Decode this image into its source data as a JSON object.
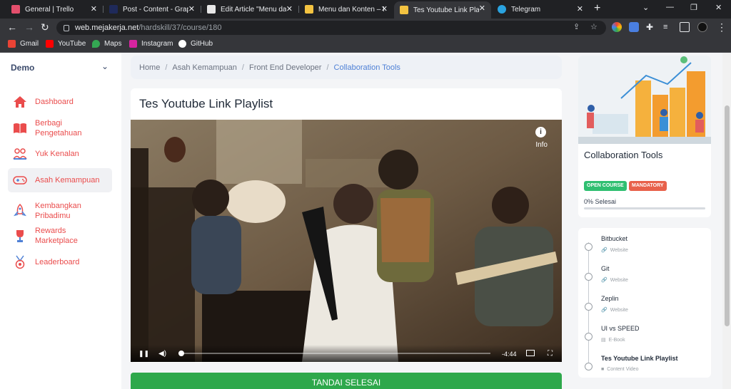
{
  "browser": {
    "tabs": [
      {
        "title": "General | Trello",
        "favicon_color": "#e34f6c"
      },
      {
        "title": "Post - Content - Graph",
        "favicon_color": "#1f2a5a"
      },
      {
        "title": "Edit Article \"Menu dan",
        "favicon_color": "#e7e7e7"
      },
      {
        "title": "Menu dan Konten – M",
        "favicon_color": "#f3c341"
      },
      {
        "title": "Tes Youtube Link Playl",
        "favicon_color": "#f3c341",
        "active": true
      },
      {
        "title": "Telegram",
        "favicon_color": "#2aa3e0"
      }
    ],
    "url_host": "web.mejakerja.net",
    "url_path": "/hardskill/37/course/180",
    "bookmarks": [
      {
        "label": "Gmail",
        "color": "#ea4335"
      },
      {
        "label": "YouTube",
        "color": "#ff0000"
      },
      {
        "label": "Maps",
        "color": "#34a853"
      },
      {
        "label": "Instagram",
        "color": "#d6249f"
      },
      {
        "label": "GitHub",
        "color": "#ffffff"
      }
    ]
  },
  "sidebar": {
    "brand": "Demo",
    "items": [
      {
        "label": "Dashboard",
        "icon": "home-icon"
      },
      {
        "label": "Berbagi Pengetahuan",
        "icon": "book-icon"
      },
      {
        "label": "Yuk Kenalan",
        "icon": "people-icon"
      },
      {
        "label": "Asah Kemampuan",
        "icon": "gamepad-icon",
        "active": true
      },
      {
        "label": "Kembangkan Pribadimu",
        "icon": "rocket-icon"
      },
      {
        "label": "Rewards Marketplace",
        "icon": "trophy-icon"
      },
      {
        "label": "Leaderboard",
        "icon": "medal-icon"
      }
    ]
  },
  "breadcrumb": {
    "items": [
      "Home",
      "Asah Kemampuan",
      "Front End Developer"
    ],
    "current": "Collaboration Tools"
  },
  "course": {
    "title": "Tes Youtube Link Playlist",
    "video": {
      "info_label": "Info",
      "time_remaining": "-4:44",
      "progress": 0.01
    },
    "done_button": "TANDAI SELESAI"
  },
  "right_panel": {
    "title": "Collaboration Tools",
    "badges": [
      {
        "label": "OPEN COURSE",
        "color": "#2fbf71"
      },
      {
        "label": "MANDATORY",
        "color": "#e8614b"
      }
    ],
    "progress_label": "0% Selesai",
    "progress": 0
  },
  "lessons": [
    {
      "name": "Bitbucket",
      "type": "Website",
      "icon": "link-icon"
    },
    {
      "name": "Git",
      "type": "Website",
      "icon": "link-icon"
    },
    {
      "name": "Zeplin",
      "type": "Website",
      "icon": "link-icon"
    },
    {
      "name": "UI vs SPEED",
      "type": "E-Book",
      "icon": "file-icon"
    },
    {
      "name": "Tes Youtube Link Playlist",
      "type": "Content Video",
      "icon": "video-icon",
      "current": true
    }
  ]
}
